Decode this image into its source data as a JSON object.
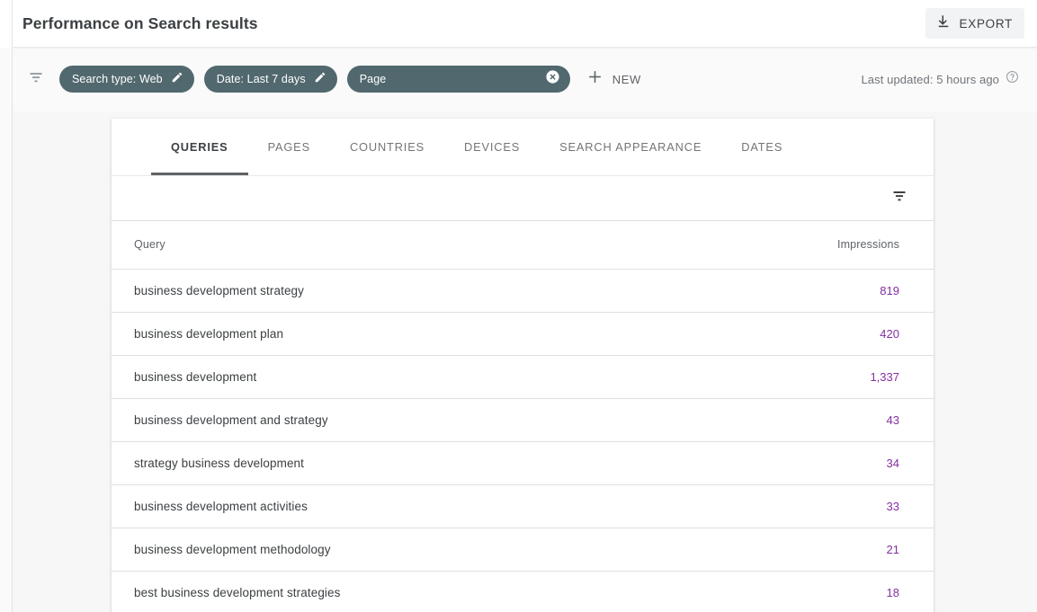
{
  "header": {
    "title": "Performance on Search results",
    "export_label": "EXPORT",
    "export_icon": "download-icon"
  },
  "filter_bar": {
    "filter_icon": "filter-list-icon",
    "chips": [
      {
        "label": "Search type: Web",
        "edit_icon": "pencil-icon"
      },
      {
        "label": "Date: Last 7 days",
        "edit_icon": "pencil-icon"
      }
    ],
    "page_chip": {
      "label": "Page",
      "clear_icon": "clear-circle-icon"
    },
    "new_button": {
      "label": "NEW",
      "icon": "plus-icon"
    },
    "last_updated": {
      "text": "Last updated: 5 hours ago",
      "help_icon": "help-circle-icon"
    }
  },
  "tabs": [
    {
      "label": "QUERIES",
      "active": true
    },
    {
      "label": "PAGES",
      "active": false
    },
    {
      "label": "COUNTRIES",
      "active": false
    },
    {
      "label": "DEVICES",
      "active": false
    },
    {
      "label": "SEARCH APPEARANCE",
      "active": false
    },
    {
      "label": "DATES",
      "active": false
    }
  ],
  "table_toolbar": {
    "filter_icon": "filter-list-icon"
  },
  "table": {
    "columns": [
      "Query",
      "Impressions"
    ],
    "rows": [
      {
        "query": "business development strategy",
        "impressions": "819"
      },
      {
        "query": "business development plan",
        "impressions": "420"
      },
      {
        "query": "business development",
        "impressions": "1,337"
      },
      {
        "query": "business development and strategy",
        "impressions": "43"
      },
      {
        "query": "strategy business development",
        "impressions": "34"
      },
      {
        "query": "business development activities",
        "impressions": "33"
      },
      {
        "query": "business development methodology",
        "impressions": "21"
      },
      {
        "query": "best business development strategies",
        "impressions": "18"
      }
    ]
  },
  "colors": {
    "chip_background": "#51686e",
    "impressions_text": "#8430a0",
    "page_background": "#fafafa",
    "tab_active_underline": "#5f6368"
  }
}
